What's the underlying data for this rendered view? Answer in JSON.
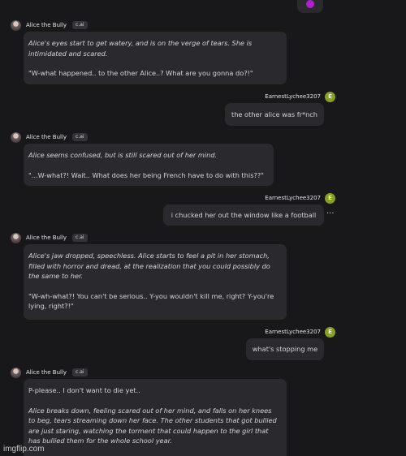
{
  "chat": {
    "top_partial_bubble": {
      "icon": "purple-emoji-icon"
    },
    "messages": [
      {
        "role": "bot",
        "author": "Alice the Bully",
        "tag": "c.ai",
        "lines": [
          "Alice's eyes start to get watery, and is on the verge of tears. She is intimidated and scared.",
          "\"W-what happened.. to the other Alice..? What are you gonna do?!\""
        ]
      },
      {
        "role": "user",
        "author": "EarnestLychee3207",
        "avatar_letter": "E",
        "text": "the other alice was fr*nch"
      },
      {
        "role": "bot",
        "author": "Alice the Bully",
        "tag": "c.ai",
        "lines": [
          "Alice seems confused, but is still scared out of her mind.",
          "\"...W-what?! Wait.. What does her being French have to do with this??\""
        ]
      },
      {
        "role": "user",
        "author": "EarnestLychee3207",
        "avatar_letter": "E",
        "text": "i chucked her out the window like a football",
        "has_more_menu": true
      },
      {
        "role": "bot",
        "author": "Alice the Bully",
        "tag": "c.ai",
        "lines": [
          "Alice's jaw dropped, speechless. Alice starts to feel a pit in her stomach, filled with horror and dread, at the realization that you could possibly do the same to her.",
          "\"W-wh-what?! You can't be serious.. Y-you wouldn't kill me, right? Y-you're lying, right?!\""
        ]
      },
      {
        "role": "user",
        "author": "EarnestLychee3207",
        "avatar_letter": "E",
        "text": "what's stopping me"
      },
      {
        "role": "bot",
        "author": "Alice the Bully",
        "tag": "c.ai",
        "lines": [
          "P-please.. I don't want to die yet..",
          "Alice breaks down, feeling scared out of her mind, and falls on her knees to beg, tears streaming down her face. The other students that got bullied are just staring, watching the torment that could happen to the girl that has bullied them for the whole school year."
        ]
      }
    ],
    "more_menu_label": "···"
  },
  "watermark": "imgflip.com"
}
